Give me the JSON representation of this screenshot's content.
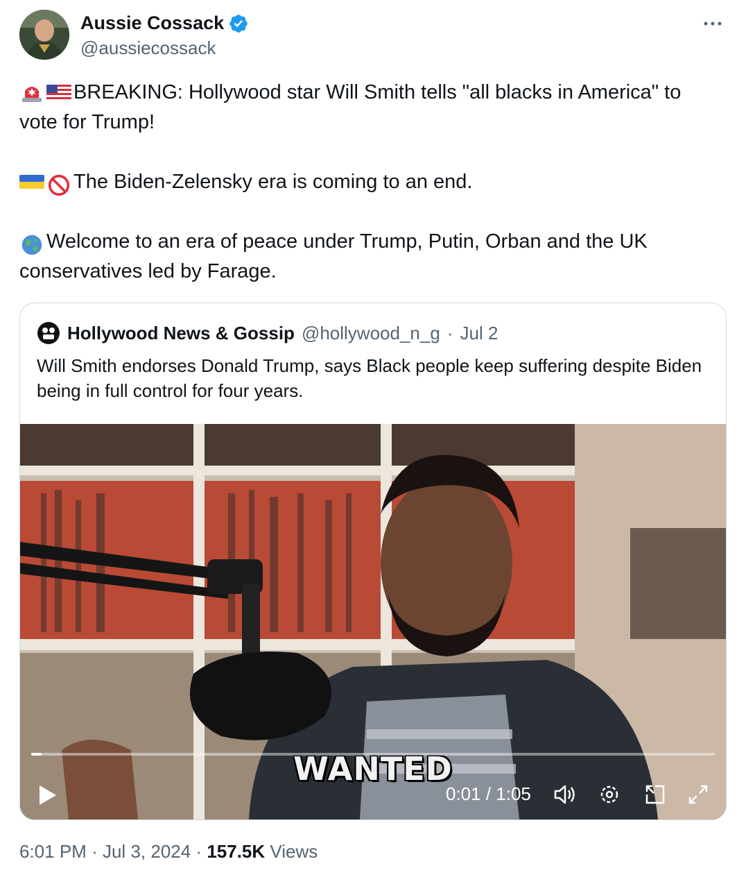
{
  "author": {
    "name": "Aussie Cossack",
    "handle": "@aussiecossack",
    "verified": true
  },
  "icons": {
    "verified": "verified-badge-icon",
    "more": "more-options-icon",
    "siren": "police-light-emoji",
    "us_flag": "us-flag-emoji",
    "ua_flag": "ukraine-flag-emoji",
    "prohibited": "prohibited-emoji",
    "globe": "globe-emoji"
  },
  "tweet": {
    "line1": "BREAKING: Hollywood star Will Smith tells \"all blacks in America\" to vote for Trump!",
    "line2": "The Biden-Zelensky era is coming to an end.",
    "line3": "Welcome to an era of peace under Trump, Putin, Orban and the UK conservatives led by Farage."
  },
  "quoted": {
    "name": "Hollywood News & Gossip",
    "handle": "@hollywood_n_g",
    "separator": "·",
    "date": "Jul 2",
    "text": "Will Smith endorses Donald Trump, says Black people keep suffering despite Biden being in full control for four years."
  },
  "video": {
    "caption": "WANTED",
    "time": "0:01 / 1:05",
    "progress": 0.015
  },
  "meta": {
    "time": "6:01 PM",
    "sep1": "·",
    "date": "Jul 3, 2024",
    "sep2": "·",
    "views_count": "157.5K",
    "views_label": "Views"
  },
  "colors": {
    "verified": "#1d9bf0",
    "secondary_text": "#536471",
    "border": "#cfd9de"
  }
}
